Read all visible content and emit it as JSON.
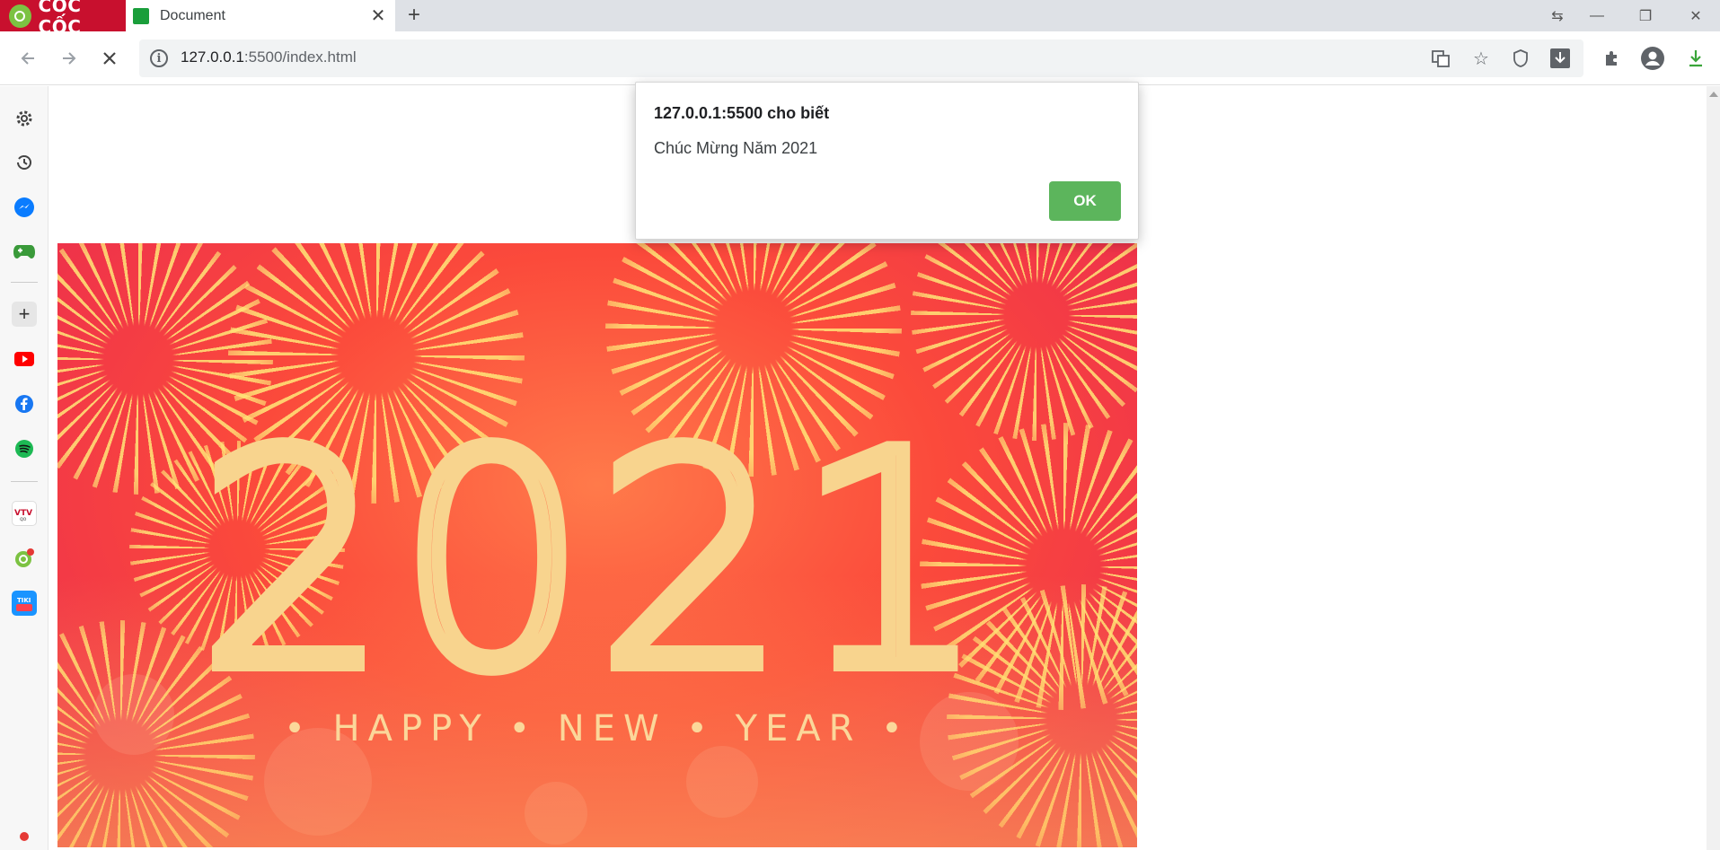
{
  "browser": {
    "brand": "CỐC CỐC",
    "tab_title": "Document",
    "tab_close_icon": "close-icon",
    "new_tab_icon": "plus-icon",
    "url_host": "127.0.0.1",
    "url_rest": ":5500/index.html"
  },
  "dialog": {
    "title": "127.0.0.1:5500 cho biết",
    "message": "Chúc Mừng Năm 2021",
    "ok_label": "OK"
  },
  "hero": {
    "year": "2021",
    "tagline": "• HAPPY • NEW • YEAR •"
  },
  "sidebar": {
    "items": [
      "settings-icon",
      "history-icon",
      "messenger-icon",
      "game-icon",
      "add-icon",
      "youtube-icon",
      "facebook-icon",
      "spotify-icon",
      "vtv-go-icon",
      "coccoc-icon",
      "tiki-icon"
    ]
  },
  "colors": {
    "ok_button": "#5cb55c",
    "brand_red": "#c8102e",
    "tab_favicon": "#1a9e3b"
  }
}
